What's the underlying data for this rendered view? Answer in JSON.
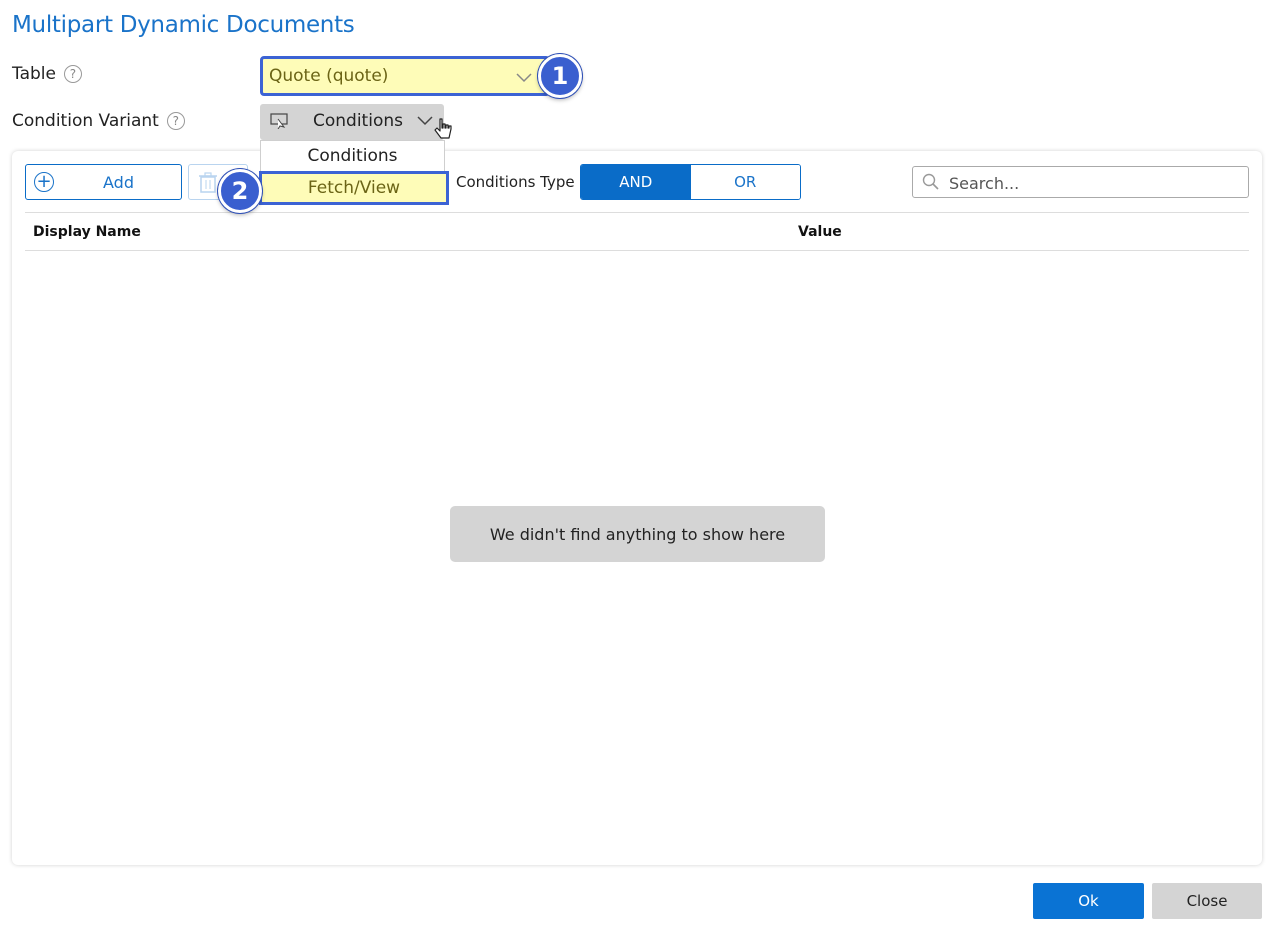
{
  "title": "Multipart Dynamic Documents",
  "form": {
    "table_label": "Table",
    "table_value": "Quote (quote)",
    "variant_label": "Condition Variant",
    "variant_value": "Conditions",
    "help_glyph": "?"
  },
  "dropdown": {
    "options": [
      "Conditions",
      "Fetch/View"
    ]
  },
  "badges": [
    "1",
    "2"
  ],
  "toolbar": {
    "add_label": "Add",
    "conditions_type_label": "Conditions Type",
    "and_label": "AND",
    "or_label": "OR",
    "selected_type": "AND",
    "search_placeholder": "Search..."
  },
  "grid": {
    "columns": [
      "Display Name",
      "Value"
    ],
    "empty_message": "We didn't find anything to show here"
  },
  "footer": {
    "ok_label": "Ok",
    "close_label": "Close"
  },
  "colors": {
    "accent": "#0a73d4",
    "highlight": "#fefcb8",
    "annotation": "#3c63d4"
  },
  "icons": [
    "help-icon",
    "chevron-down-icon",
    "cursor-select-icon",
    "hand-pointer-icon",
    "plus-circle-icon",
    "trash-icon",
    "search-icon"
  ]
}
